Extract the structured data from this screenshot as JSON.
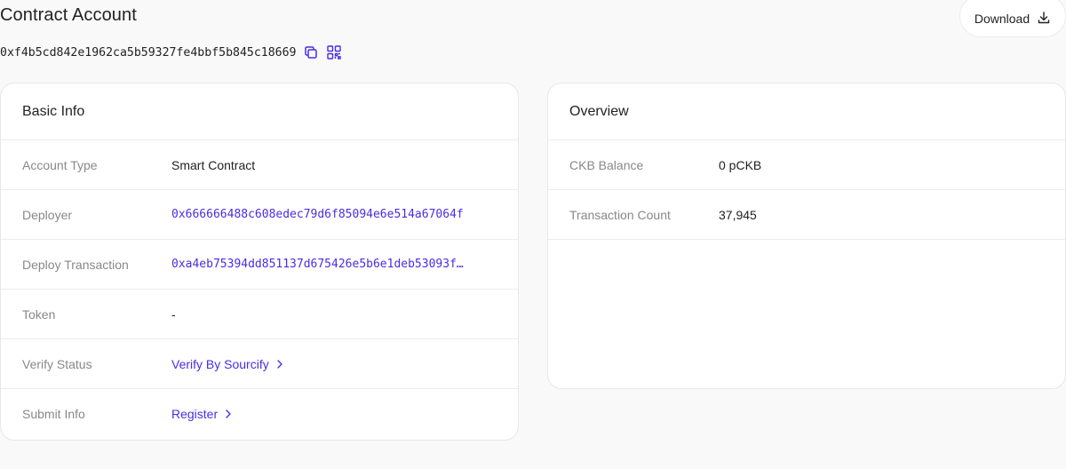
{
  "header": {
    "title": "Contract Account",
    "download_label": "Download",
    "address": "0xf4b5cd842e1962ca5b59327fe4bbf5b845c18669"
  },
  "basic_info": {
    "title": "Basic Info",
    "rows": [
      {
        "label": "Account Type",
        "value": "Smart Contract"
      },
      {
        "label": "Deployer",
        "value": "0x666666488c608edec79d6f85094e6e514a67064f"
      },
      {
        "label": "Deploy Transaction",
        "value": "0xa4eb75394dd851137d675426e5b6e1deb53093f…"
      },
      {
        "label": "Token",
        "value": "-"
      },
      {
        "label": "Verify Status",
        "value": "Verify By Sourcify"
      },
      {
        "label": "Submit Info",
        "value": "Register"
      }
    ]
  },
  "overview": {
    "title": "Overview",
    "rows": [
      {
        "label": "CKB Balance",
        "value": "0 pCKB"
      },
      {
        "label": "Transaction Count",
        "value": "37,945"
      }
    ]
  },
  "colors": {
    "accent": "#4c2ce4",
    "label": "#888888",
    "border": "#ececec"
  },
  "icons": {
    "download": "download-icon",
    "copy": "copy-icon",
    "qr": "qr-code-icon",
    "chevron": "chevron-right-icon"
  }
}
